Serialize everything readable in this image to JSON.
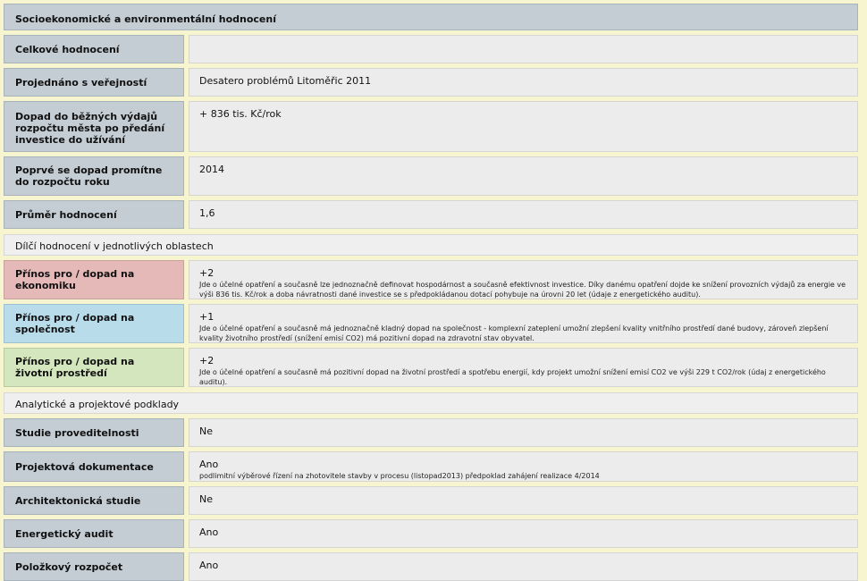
{
  "section_header": "Socioekonomické a environmentální hodnocení",
  "rows_top": [
    {
      "label": "Celkové hodnocení",
      "value": ""
    },
    {
      "label": "Projednáno s veřejností",
      "value": "Desatero problémů Litoměřic 2011"
    },
    {
      "label": "Dopad do běžných výdajů rozpočtu města po předání investice do užívání",
      "value": "+ 836 tis. Kč/rok"
    },
    {
      "label": "Poprvé se dopad promítne do rozpočtu roku",
      "value": "2014"
    },
    {
      "label": "Průměr hodnocení",
      "value": "1,6"
    }
  ],
  "subheader_areas": "Dílčí hodnocení v jednotlivých oblastech",
  "areas": [
    {
      "label": "Přínos pro / dopad na ekonomiku",
      "color": "#e5b9b7",
      "score": "+2",
      "note": "Jde o účelné opatření a současně lze jednoznačně definovat hospodárnost a současně efektivnost investice. Díky danému opatření dojde ke snížení provozních výdajů za energie ve výši 836 tis. Kč/rok a doba návratnosti dané investice se s předpokládanou dotací pohybuje na úrovni 20 let (údaje z energetického auditu)."
    },
    {
      "label": "Přínos pro / dopad na společnost",
      "color": "#b9dceb",
      "score": "+1",
      "note": "Jde o účelné opatření a současně má jednoznačně kladný dopad na společnost - komplexní zateplení umožní zlepšení kvality vnitřního prostředí dané budovy, zároveň zlepšení kvality životního prostředí (snížení emisí CO2) má pozitivní dopad na zdravotní stav obyvatel."
    },
    {
      "label": "Přínos pro / dopad na životní prostředí",
      "color": "#d4e6bd",
      "score": "+2",
      "note": "Jde o účelné opatření a současně má pozitivní dopad na životní prostředí a spotřebu energií, kdy projekt umožní snížení emisí CO2 ve výši 229 t CO2/rok (údaj z energetického auditu)."
    }
  ],
  "subheader_docs": "Analytické a projektové podklady",
  "docs": [
    {
      "label": "Studie proveditelnosti",
      "value": "Ne",
      "note": ""
    },
    {
      "label": "Projektová dokumentace",
      "value": "Ano",
      "note": "podlimitní výběrové řízení na zhotovitele stavby v procesu (listopad2013) předpoklad zahájení realizace 4/2014"
    },
    {
      "label": "Architektonická studie",
      "value": "Ne",
      "note": ""
    },
    {
      "label": "Energetický audit",
      "value": "Ano",
      "note": ""
    },
    {
      "label": "Položkový rozpočet",
      "value": "Ano",
      "note": ""
    }
  ]
}
